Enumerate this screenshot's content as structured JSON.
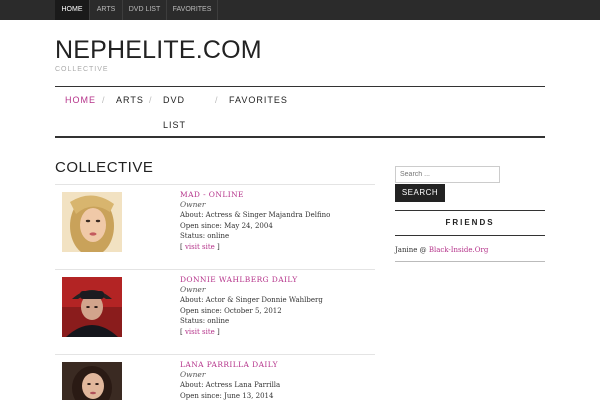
{
  "topbar": {
    "items": [
      "HOME",
      "ARTS",
      "DVD LIST",
      "FAVORITES"
    ]
  },
  "header": {
    "title": "NEPHELITE.COM",
    "description": "COLLECTIVE"
  },
  "nav": {
    "home": "HOME",
    "arts": "ARTS",
    "dvd_line1": "DVD",
    "dvd_line2": "LIST",
    "favorites": "FAVORITES",
    "separator": "/"
  },
  "page": {
    "title": "COLLECTIVE"
  },
  "entries": [
    {
      "name": "MAD - ONLINE",
      "role": "Owner",
      "about": "About: Actress & Singer Majandra Delfino",
      "open": "Open since: May 24, 2004",
      "status": "Status: online",
      "visit_open": "[ ",
      "visit": "visit site",
      "visit_close": " ]"
    },
    {
      "name": "DONNIE WAHLBERG DAILY",
      "role": "Owner",
      "about": "About: Actor & Singer Donnie Wahlberg",
      "open": "Open since: October 5, 2012",
      "status": "Status: online",
      "visit_open": "[ ",
      "visit": "visit site",
      "visit_close": " ]"
    },
    {
      "name": "LANA PARRILLA DAILY",
      "role": "Owner",
      "about": "About: Actress Lana Parrilla",
      "open": "Open since: June 13, 2014"
    }
  ],
  "sidebar": {
    "search_placeholder": "Search ...",
    "search_button": "SEARCH",
    "widget_title": "FRIENDS",
    "friend_prefix": "Janine @ ",
    "friend_link": "Black-Inside.Org"
  },
  "colors": {
    "accent": "#b5338a",
    "topbar": "#2b2b2b"
  }
}
